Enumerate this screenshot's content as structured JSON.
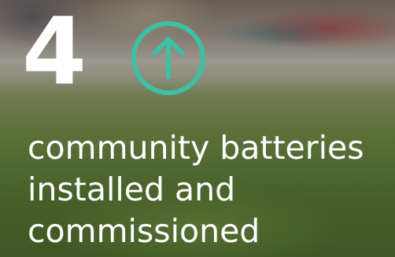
{
  "stat": {
    "number": "4",
    "caption_lines": [
      "community batteries",
      "installed and",
      "commissioned"
    ]
  },
  "icons": {
    "trend": "arrow-up-circle-icon"
  },
  "colors": {
    "accent": "#3fbfa4",
    "text": "#ffffff"
  }
}
